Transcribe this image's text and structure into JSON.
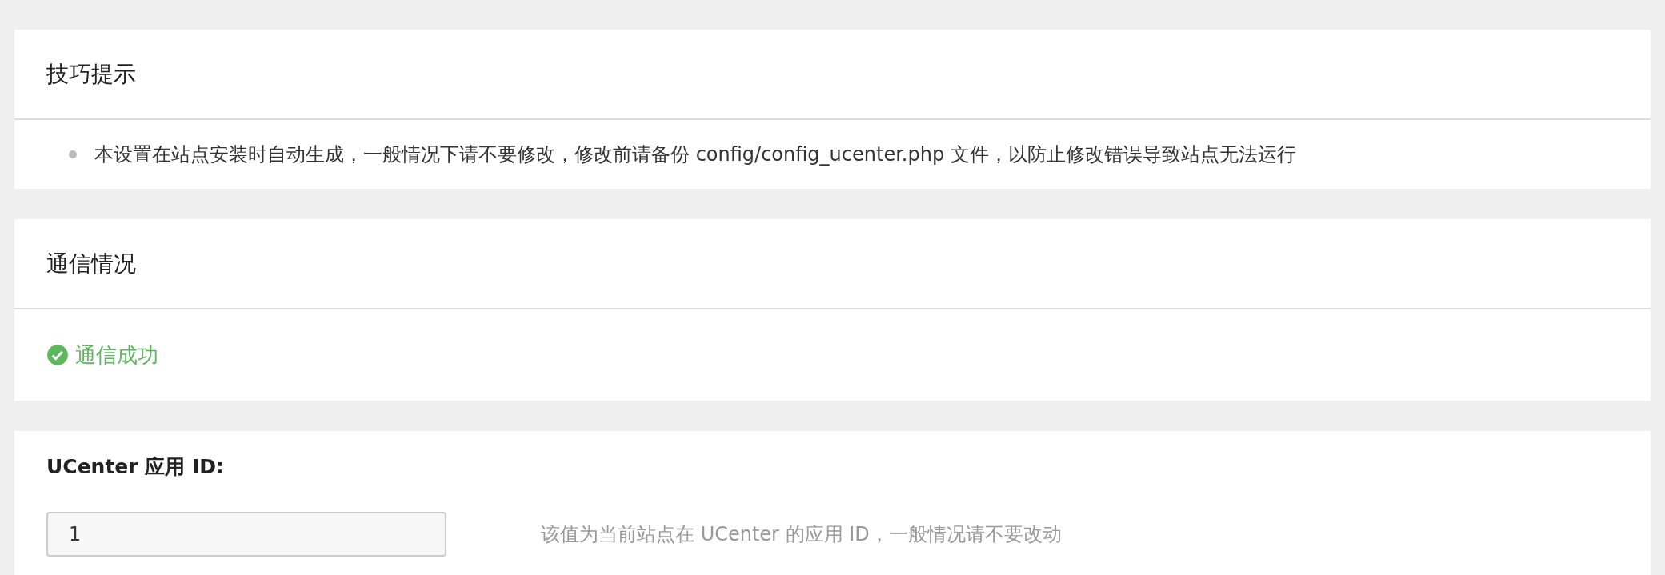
{
  "tips": {
    "title": "技巧提示",
    "items": [
      "本设置在站点安装时自动生成，一般情况下请不要修改，修改前请备份 config/config_ucenter.php 文件，以防止修改错误导致站点无法运行"
    ]
  },
  "communication": {
    "title": "通信情况",
    "status": {
      "kind": "success",
      "text": "通信成功"
    }
  },
  "settings": [
    {
      "label": "UCenter 应用 ID:",
      "value": "1",
      "hint": "该值为当前站点在 UCenter 的应用 ID，一般情况请不要改动"
    }
  ]
}
